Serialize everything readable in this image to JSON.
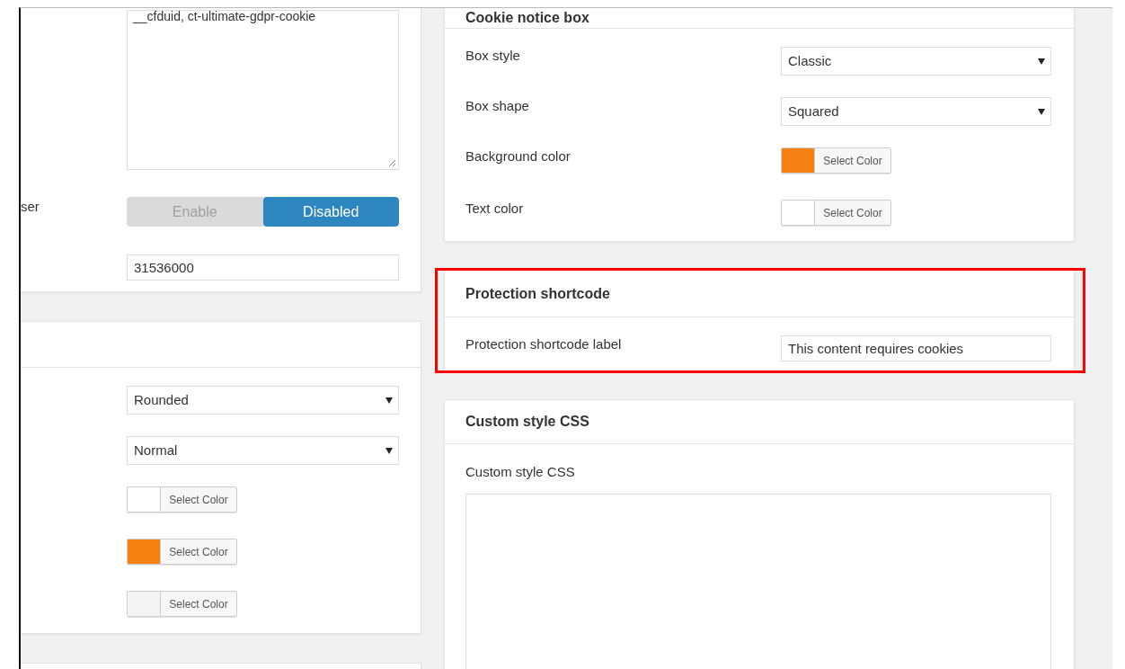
{
  "left_column": {
    "sections": [
      {
        "rows": [
          {
            "kind": "textarea",
            "value": "__cfduid, ct-ultimate-gdpr-cookie"
          },
          {
            "kind": "toggle",
            "label": "ser",
            "options": [
              {
                "label": "Enable",
                "selected": false
              },
              {
                "label": "Disabled",
                "selected": true
              }
            ]
          },
          {
            "kind": "text",
            "value": "31536000"
          }
        ]
      },
      {
        "rows": [
          {
            "kind": "select",
            "value": "Rounded"
          },
          {
            "kind": "select",
            "value": "Normal"
          },
          {
            "kind": "color",
            "color": "#ffffff",
            "button": "Select Color"
          },
          {
            "kind": "color",
            "color": "#f58113",
            "button": "Select Color"
          },
          {
            "kind": "color",
            "color": "#f5f5f5",
            "button": "Select Color"
          }
        ]
      }
    ]
  },
  "right_column": {
    "sections": [
      {
        "title": "Cookie notice box",
        "highlighted": false,
        "rows": [
          {
            "kind": "select",
            "label": "Box style",
            "value": "Classic"
          },
          {
            "kind": "select",
            "label": "Box shape",
            "value": "Squared"
          },
          {
            "kind": "color",
            "label": "Background color",
            "color": "#f58113",
            "button": "Select Color"
          },
          {
            "kind": "color",
            "label": "Text color",
            "color": "#ffffff",
            "button": "Select Color"
          }
        ]
      },
      {
        "title": "Protection shortcode",
        "highlighted": true,
        "rows": [
          {
            "kind": "text",
            "label": "Protection shortcode label",
            "value": "This content requires cookies"
          }
        ]
      },
      {
        "title": "Custom style CSS",
        "highlighted": false,
        "rows": [
          {
            "kind": "textarea_block",
            "label": "Custom style CSS"
          }
        ]
      }
    ]
  }
}
